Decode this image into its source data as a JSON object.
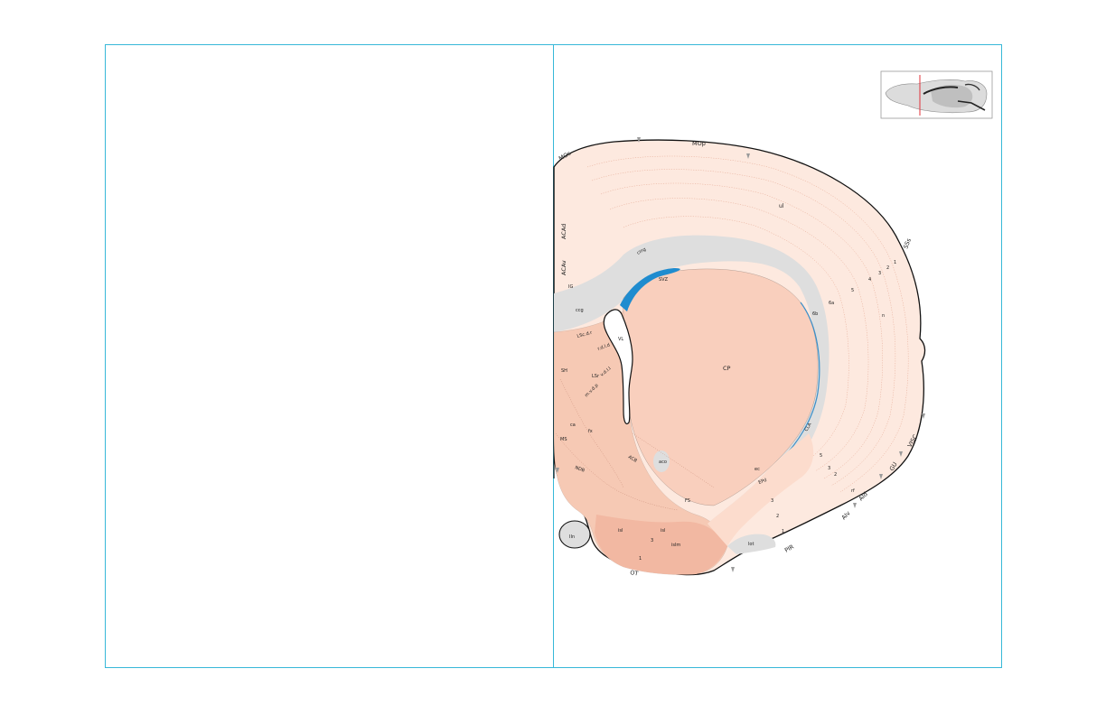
{
  "colors": {
    "frame": "#37b8d8",
    "cortex": "#fde9df",
    "striatum": "#f9cfbd",
    "pallidum": "#f5c2ad",
    "septum": "#f6c9b4",
    "fiber_tract": "#dedede",
    "ventricle": "#ffffff",
    "svz": "#1f8ccf",
    "outline": "#111111"
  },
  "labels": {
    "mos": "MOs",
    "mop": "MOp",
    "ssp_ul": "ul",
    "acad": "ACAd",
    "acav": "ACAv",
    "ig": "IG",
    "ccg": "ccg",
    "cing": "cing",
    "svz": "SVZ",
    "l1": "1",
    "l2": "2",
    "l3": "3",
    "l4": "4",
    "l5": "5",
    "l6a": "6a",
    "l6b": "6b",
    "sss": "SSs",
    "sssn": "n",
    "vl": "VL",
    "cp": "CP",
    "lsc": "LSc.d.r",
    "lsc_sub": "r.d.l.d",
    "lsr": "LSr",
    "lsr_sub1": "v.d.l.l",
    "lsr_sub2": "m.v.d.p",
    "sh": "SH",
    "ca": "ca",
    "ms": "MS",
    "ndb": "NDB",
    "fx": "fx",
    "acb": "ACB",
    "aco": "aco",
    "cla": "CLA",
    "ec": "ec",
    "epd": "EPd",
    "fs": "FS",
    "ot": "OT",
    "isl": "isl",
    "isl2": "isl",
    "islm": "islm",
    "ot1": "1",
    "ot3": "3",
    "lot": "lot",
    "pir": "PIR",
    "rf": "rf",
    "aid": "AId",
    "aiv": "AIv",
    "gu": "GU",
    "visc": "VISC",
    "iin": "IIn",
    "gu5": "5",
    "gu3": "3",
    "gu2": "2",
    "pir3": "3",
    "pir2": "2",
    "pir1": "1"
  }
}
